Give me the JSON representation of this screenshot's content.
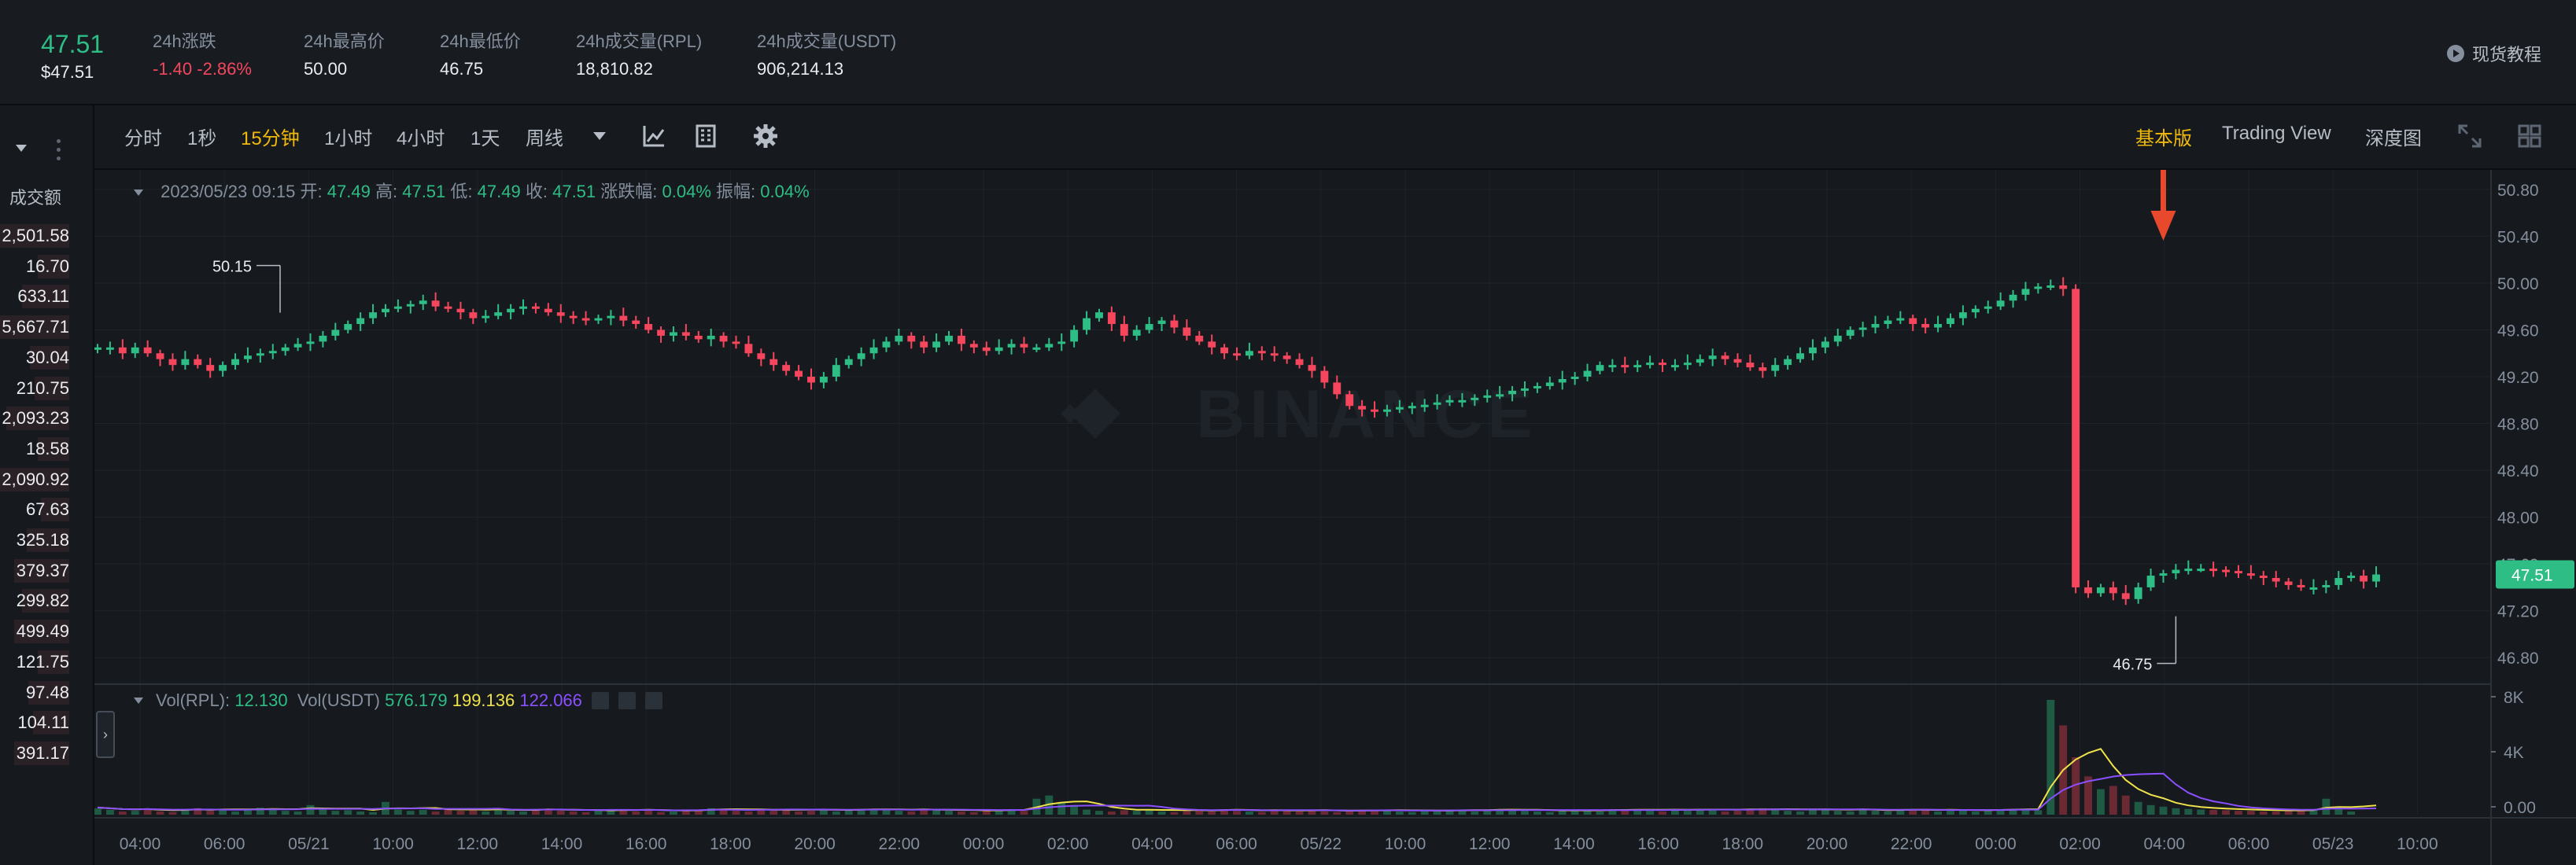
{
  "ticker": {
    "last_price": "47.51",
    "last_price_usd": "$47.51",
    "stats": [
      {
        "label": "24h涨跌",
        "value": "-1.40 -2.86%",
        "negative": true
      },
      {
        "label": "24h最高价",
        "value": "50.00"
      },
      {
        "label": "24h最低价",
        "value": "46.75"
      },
      {
        "label": "24h成交量(RPL)",
        "value": "18,810.82"
      },
      {
        "label": "24h成交量(USDT)",
        "value": "906,214.13"
      }
    ],
    "tutorial_label": "现货教程"
  },
  "left_panel": {
    "title": "成交额",
    "rows": [
      "2,501.58",
      "16.70",
      "633.11",
      "5,667.71",
      "30.04",
      "210.75",
      "2,093.23",
      "18.58",
      "2,090.92",
      "67.63",
      "325.18",
      "379.37",
      "299.82",
      "499.49",
      "121.75",
      "97.48",
      "104.11",
      "391.17"
    ]
  },
  "toolbar": {
    "intervals": [
      "分时",
      "1秒",
      "15分钟",
      "1小时",
      "4小时",
      "1天",
      "周线"
    ],
    "active_interval": "15分钟",
    "views": [
      "基本版",
      "Trading View",
      "深度图"
    ],
    "active_view": "基本版"
  },
  "ohlc": {
    "datetime": "2023/05/23 09:15",
    "open_label": "开:",
    "open": "47.49",
    "high_label": "高:",
    "high": "47.51",
    "low_label": "低:",
    "low": "47.49",
    "close_label": "收:",
    "close": "47.51",
    "change_label": "涨跌幅:",
    "change": "0.04%",
    "amp_label": "振幅:",
    "amp": "0.04%"
  },
  "volume_legend": {
    "vol_rpl_label": "Vol(RPL):",
    "vol_rpl": "12.130",
    "vol_usdt_label": "Vol(USDT)",
    "ma1": "576.179",
    "ma2": "199.136",
    "ma3": "122.066"
  },
  "watermark": "BINANCE",
  "colors": {
    "up": "#2ebd85",
    "down": "#f6465d",
    "accent": "#f0b90b",
    "arrow": "#e8482c",
    "ma_yellow": "#f0e24b",
    "ma_purple": "#8a4fff"
  },
  "chart_data": {
    "type": "candlestick",
    "price_axis_ticks": [
      "50.80",
      "50.40",
      "50.00",
      "49.60",
      "49.20",
      "48.80",
      "48.40",
      "48.00",
      "47.60",
      "47.20",
      "46.80"
    ],
    "ylim": [
      46.6,
      50.9
    ],
    "current_price_label": "47.51",
    "high_marker": "50.15",
    "low_marker": "46.75",
    "volume_axis_ticks": [
      "8K",
      "4K",
      "0.00"
    ],
    "time_ticks": [
      "04:00",
      "06:00",
      "05/21",
      "10:00",
      "12:00",
      "14:00",
      "16:00",
      "18:00",
      "20:00",
      "22:00",
      "00:00",
      "02:00",
      "04:00",
      "06:00",
      "05/22",
      "10:00",
      "12:00",
      "14:00",
      "16:00",
      "18:00",
      "20:00",
      "22:00",
      "00:00",
      "02:00",
      "04:00",
      "06:00",
      "05/23",
      "10:00"
    ],
    "close_series": [
      49.45,
      49.45,
      49.4,
      49.45,
      49.4,
      49.35,
      49.3,
      49.35,
      49.3,
      49.25,
      49.3,
      49.35,
      49.38,
      49.4,
      49.42,
      49.45,
      49.48,
      49.5,
      49.55,
      49.6,
      49.65,
      49.7,
      49.75,
      49.78,
      49.8,
      49.82,
      49.85,
      49.8,
      49.78,
      49.75,
      49.7,
      49.72,
      49.75,
      49.78,
      49.8,
      49.78,
      49.75,
      49.72,
      49.7,
      49.68,
      49.7,
      49.72,
      49.68,
      49.65,
      49.6,
      49.55,
      49.58,
      49.55,
      49.52,
      49.55,
      49.5,
      49.48,
      49.4,
      49.35,
      49.3,
      49.25,
      49.2,
      49.15,
      49.2,
      49.3,
      49.35,
      49.4,
      49.45,
      49.5,
      49.55,
      49.5,
      49.45,
      49.5,
      49.55,
      49.48,
      49.45,
      49.42,
      49.45,
      49.48,
      49.45,
      49.45,
      49.48,
      49.5,
      49.6,
      49.7,
      49.75,
      49.65,
      49.55,
      49.6,
      49.65,
      49.68,
      49.62,
      49.55,
      49.5,
      49.45,
      49.4,
      49.38,
      49.42,
      49.4,
      49.38,
      49.35,
      49.3,
      49.25,
      49.15,
      49.05,
      48.95,
      48.92,
      48.9,
      48.92,
      48.94,
      48.95,
      48.96,
      48.98,
      49.0,
      49.0,
      49.02,
      49.04,
      49.05,
      49.08,
      49.1,
      49.12,
      49.15,
      49.18,
      49.2,
      49.25,
      49.3,
      49.3,
      49.28,
      49.3,
      49.32,
      49.3,
      49.3,
      49.32,
      49.35,
      49.38,
      49.35,
      49.32,
      49.28,
      49.25,
      49.3,
      49.35,
      49.4,
      49.45,
      49.5,
      49.55,
      49.6,
      49.62,
      49.65,
      49.68,
      49.7,
      49.65,
      49.62,
      49.65,
      49.7,
      49.75,
      49.78,
      49.8,
      49.85,
      49.9,
      49.95,
      49.97,
      49.98,
      49.95,
      47.4,
      47.35,
      47.4,
      47.35,
      47.3,
      47.4,
      47.5,
      47.52,
      47.55,
      47.56,
      47.56,
      47.55,
      47.54,
      47.52,
      47.5,
      47.48,
      47.45,
      47.42,
      47.4,
      47.4,
      47.42,
      47.48,
      47.5,
      47.45,
      47.51
    ],
    "volume_series": [
      20,
      15,
      10,
      12,
      18,
      10,
      8,
      14,
      20,
      12,
      15,
      10,
      14,
      22,
      16,
      12,
      10,
      30,
      18,
      12,
      14,
      10,
      8,
      40,
      16,
      12,
      15,
      10,
      20,
      12,
      14,
      10,
      16,
      12,
      10,
      14,
      18,
      12,
      10,
      8,
      12,
      14,
      16,
      10,
      12,
      8,
      10,
      14,
      12,
      20,
      16,
      12,
      10,
      14,
      12,
      18,
      10,
      12,
      14,
      10,
      16,
      12,
      18,
      14,
      12,
      10,
      16,
      14,
      12,
      10,
      8,
      12,
      14,
      16,
      12,
      50,
      60,
      40,
      30,
      16,
      12,
      10,
      14,
      12,
      16,
      10,
      8,
      12,
      14,
      10,
      16,
      12,
      10,
      8,
      12,
      14,
      10,
      12,
      10,
      8,
      10,
      12,
      14,
      12,
      10,
      8,
      12,
      10,
      12,
      14,
      10,
      12,
      16,
      14,
      12,
      10,
      8,
      12,
      14,
      12,
      10,
      12,
      14,
      16,
      12,
      10,
      14,
      12,
      18,
      14,
      10,
      12,
      16,
      20,
      14,
      12,
      10,
      16,
      18,
      12,
      10,
      14,
      12,
      10,
      16,
      12,
      14,
      10,
      12,
      14,
      10,
      12,
      14,
      16,
      18,
      14,
      360,
      280,
      180,
      120,
      80,
      90,
      60,
      40,
      30,
      25,
      20,
      18,
      16,
      15,
      14,
      12,
      12,
      10,
      10,
      12,
      12,
      14,
      50,
      20,
      10
    ]
  }
}
